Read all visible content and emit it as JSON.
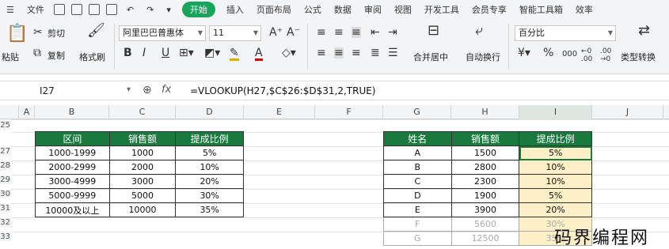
{
  "menubar": {
    "file": "文件",
    "tabs": [
      "开始",
      "插入",
      "页面布局",
      "公式",
      "数据",
      "审阅",
      "视图",
      "开发工具",
      "会员专享",
      "智能工具箱",
      "效率"
    ]
  },
  "ribbon": {
    "paste": "粘贴",
    "cut": "剪切",
    "copy": "复制",
    "format_painter": "格式刷",
    "font_name": "阿里巴巴普惠体",
    "font_size": "11",
    "merge_center": "合并居中",
    "wrap_text": "自动换行",
    "number_format": "百分比",
    "type_convert": "类型转换",
    "currency_symbol": "¥",
    "percent_symbol": "%",
    "thousands_symbol": "000",
    "inc_decimal": "←0 .00",
    "dec_decimal": ".00 →0"
  },
  "formula_bar": {
    "name_box": "I27",
    "fx": "fx",
    "formula": "=VLOOKUP(H27,$C$26:$D$31,2,TRUE)"
  },
  "columns": [
    "A",
    "B",
    "C",
    "D",
    "E",
    "F",
    "G",
    "H",
    "I",
    "J"
  ],
  "rows": [
    "25",
    "27",
    "28",
    "29",
    "30",
    "31",
    "32",
    "33"
  ],
  "table1": {
    "headers": [
      "区间",
      "销售额",
      "提成比例"
    ],
    "rows": [
      [
        "1000-1999",
        "1000",
        "5%"
      ],
      [
        "2000-2999",
        "2000",
        "10%"
      ],
      [
        "3000-4999",
        "3000",
        "20%"
      ],
      [
        "5000-9999",
        "5000",
        "30%"
      ],
      [
        "10000及以上",
        "10000",
        "35%"
      ]
    ]
  },
  "table2": {
    "headers": [
      "姓名",
      "销售额",
      "提成比例"
    ],
    "rows": [
      [
        "A",
        "1500",
        "5%"
      ],
      [
        "B",
        "2800",
        "10%"
      ],
      [
        "C",
        "2300",
        "10%"
      ],
      [
        "D",
        "1900",
        "5%"
      ],
      [
        "E",
        "3900",
        "20%"
      ],
      [
        "F",
        "5600",
        "30%"
      ],
      [
        "G",
        "12500",
        "35%"
      ]
    ]
  },
  "watermark": "码界编程网",
  "colors": {
    "accent": "#1aa35a",
    "header_fill": "#1a7a3e",
    "highlight": "#fdf0c6"
  }
}
